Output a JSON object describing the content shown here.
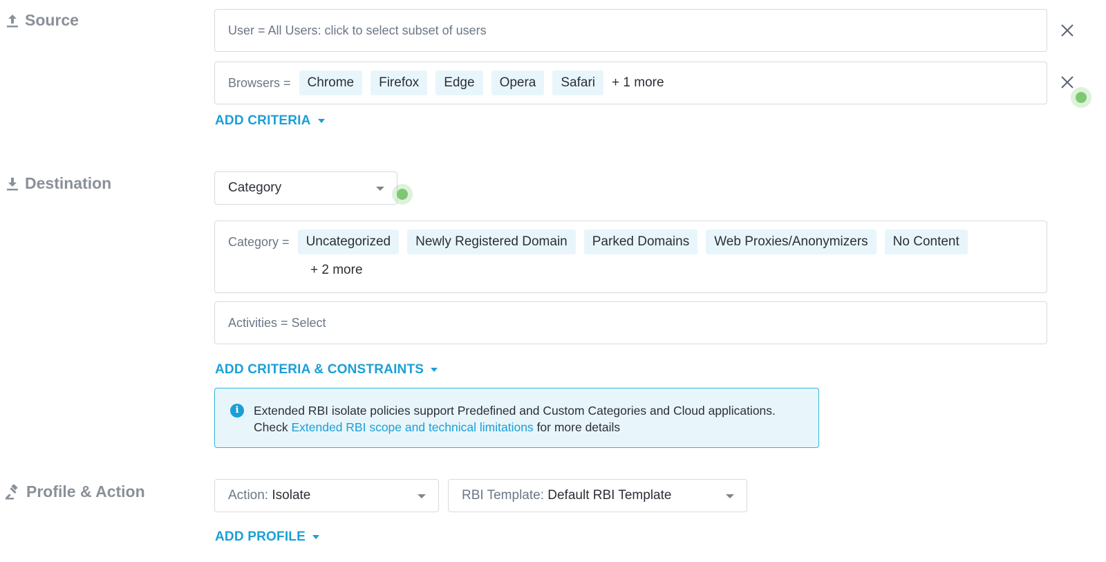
{
  "source": {
    "label": "Source",
    "icon": "upload-icon",
    "user_criteria": "User = All Users: click to select subset of users",
    "browsers": {
      "label": "Browsers =",
      "chips": [
        "Chrome",
        "Firefox",
        "Edge",
        "Opera",
        "Safari"
      ],
      "more": "+ 1 more"
    },
    "add_criteria": "ADD CRITERIA"
  },
  "destination": {
    "label": "Destination",
    "icon": "download-icon",
    "type_select": "Category",
    "category": {
      "label": "Category =",
      "chips": [
        "Uncategorized",
        "Newly Registered Domain",
        "Parked Domains",
        "Web Proxies/Anonymizers",
        "No Content"
      ],
      "more": "+ 2 more"
    },
    "activities": "Activities = Select",
    "add_criteria": "ADD CRITERIA & CONSTRAINTS",
    "info": {
      "line1": "Extended RBI isolate policies support Predefined and Custom Categories and Cloud applications.",
      "line2_prefix": "Check",
      "link": "Extended RBI scope and technical limitations",
      "line2_suffix": "for more details"
    }
  },
  "profile": {
    "label": "Profile & Action",
    "icon": "gavel-icon",
    "action_label": "Action:",
    "action_value": "Isolate",
    "template_label": "RBI Template:",
    "template_value": "Default RBI Template",
    "add_profile": "ADD PROFILE"
  },
  "colors": {
    "accent": "#1a9fd6",
    "chip_bg": "#e8f6fb",
    "section_label": "#8a9098",
    "green_indicator": "#7ec872"
  }
}
